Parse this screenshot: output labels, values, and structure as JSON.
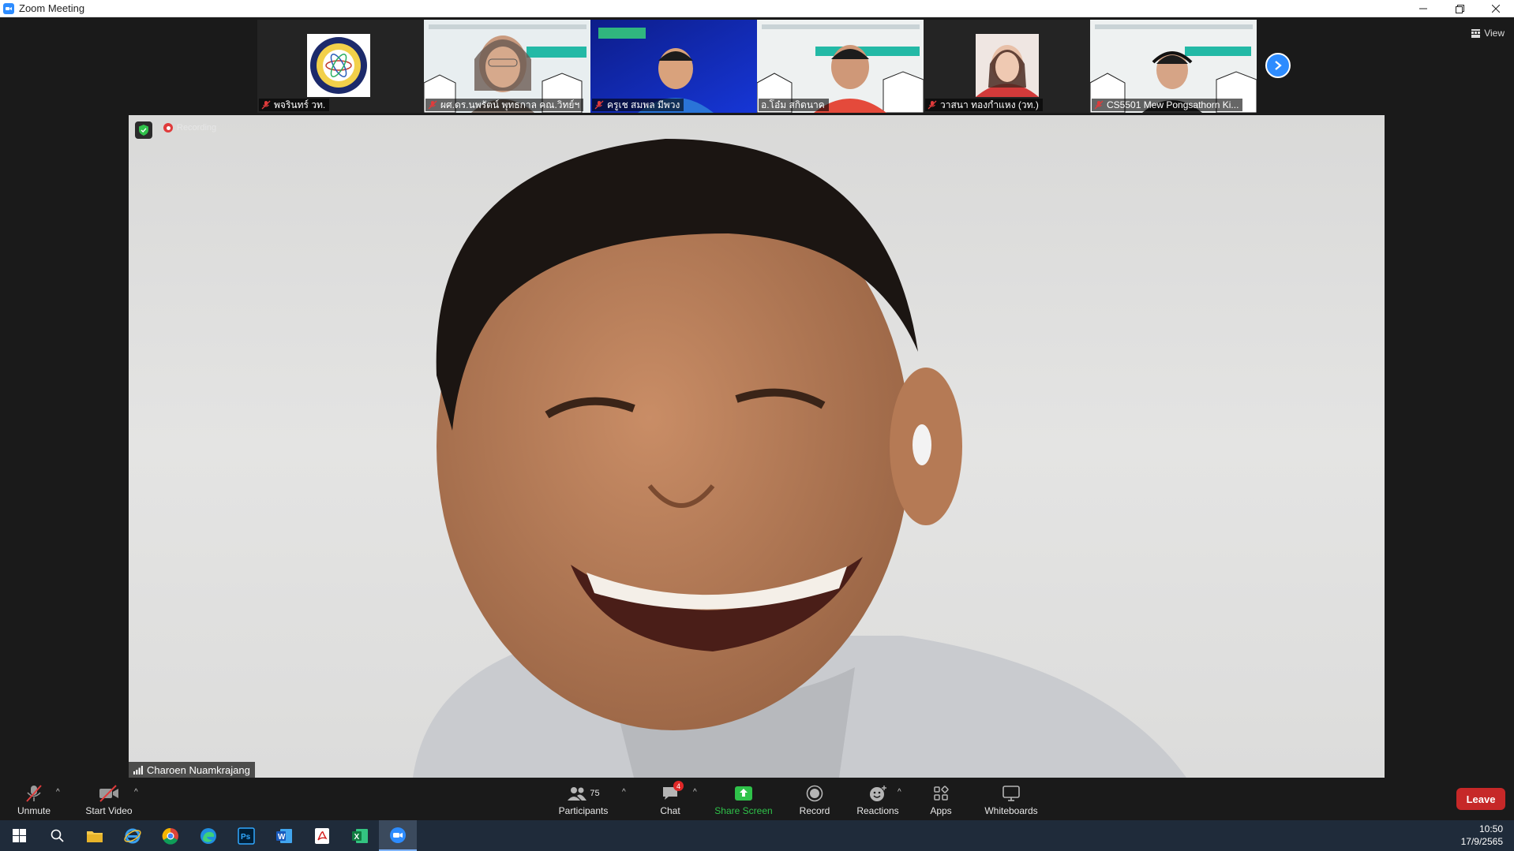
{
  "window": {
    "title": "Zoom Meeting"
  },
  "gallery": {
    "participants": [
      {
        "name": "พจรินทร์ วท.",
        "kind": "logo"
      },
      {
        "name": "ผศ.ดร.นพรัตน์ พุทธกาล คณ.วิทย์ฯ",
        "kind": "video"
      },
      {
        "name": "ครูเช สมพล มีพวง",
        "kind": "video"
      },
      {
        "name": "อ.โอ๋ม สกิดนาค",
        "kind": "video"
      },
      {
        "name": "วาสนา ทองกำแหง (วท.)",
        "kind": "photo"
      },
      {
        "name": "CS5501 Mew Pongsathorn Ki...",
        "kind": "video"
      }
    ],
    "view_label": "View"
  },
  "main_video": {
    "speaker_name": "Charoen Nuamkrajang",
    "recording_label": "Recording"
  },
  "toolbar": {
    "unmute": "Unmute",
    "start_video": "Start Video",
    "participants": "Participants",
    "participants_count": "75",
    "chat": "Chat",
    "chat_badge": "4",
    "share_screen": "Share Screen",
    "record": "Record",
    "reactions": "Reactions",
    "apps": "Apps",
    "whiteboards": "Whiteboards",
    "leave": "Leave"
  },
  "taskbar": {
    "time": "10:50",
    "date": "17/9/2565"
  },
  "colors": {
    "accent": "#2d8cff",
    "share_green": "#2fc24a",
    "leave_red": "#c62828"
  }
}
